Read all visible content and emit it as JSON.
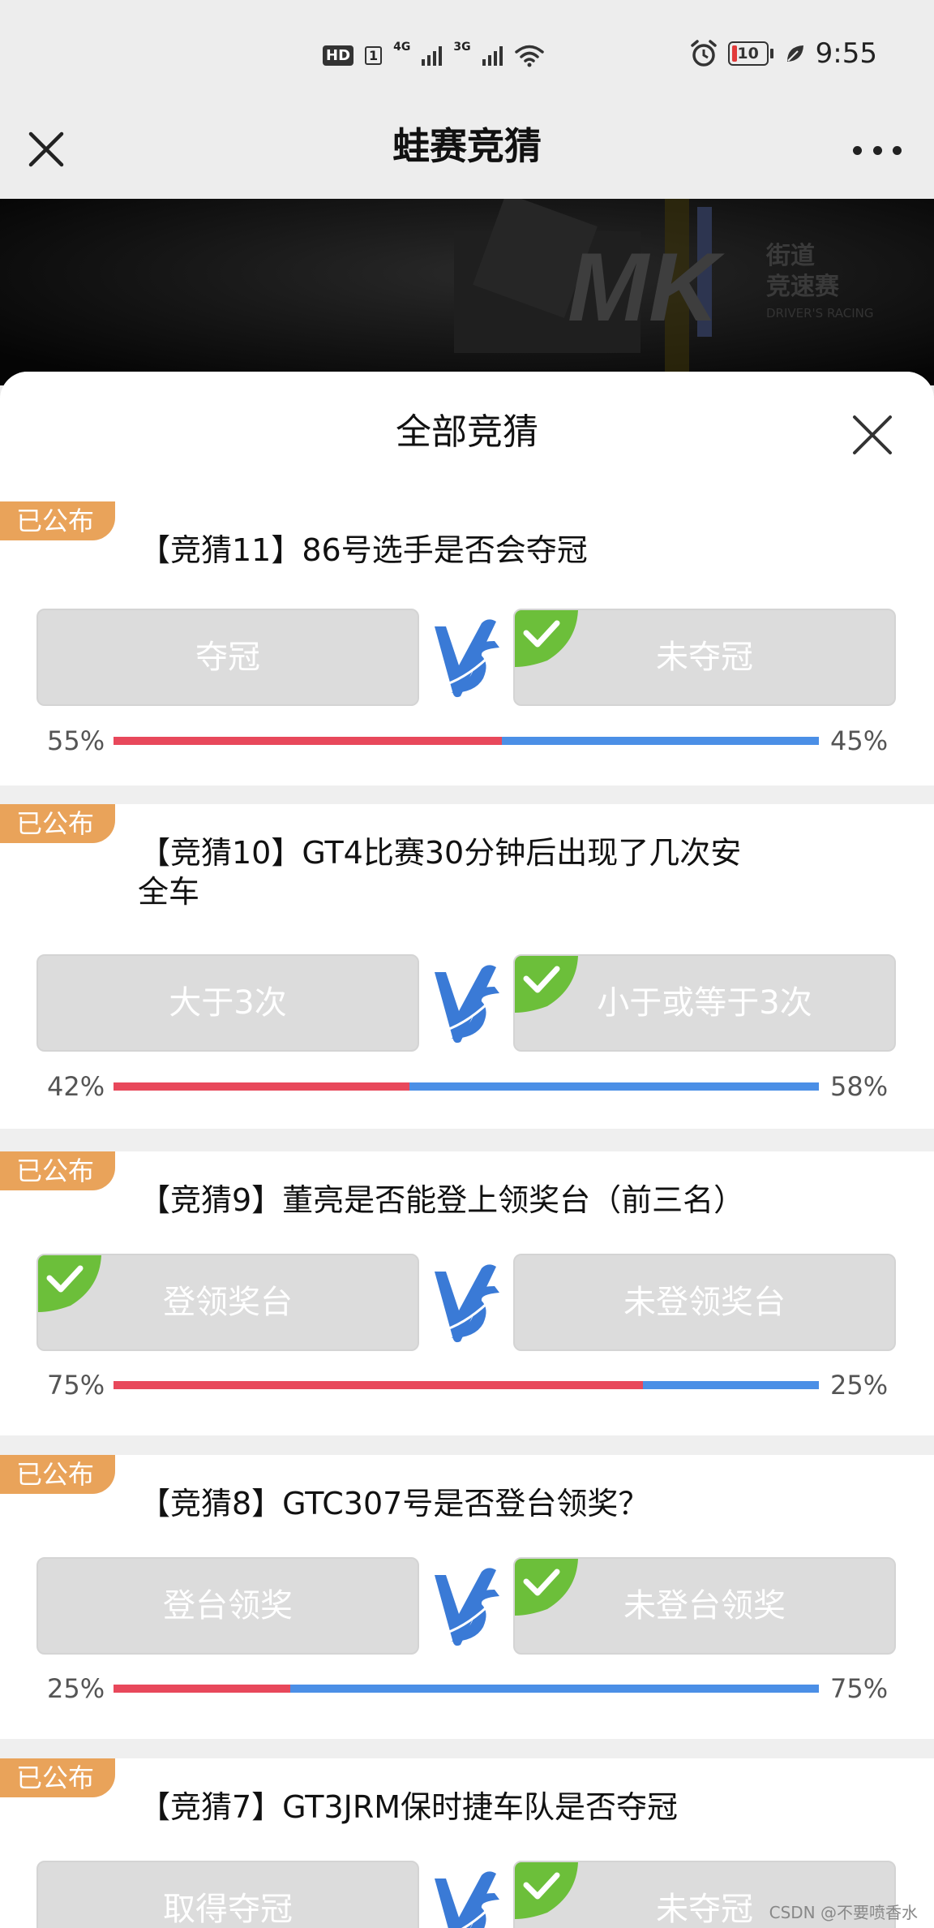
{
  "status_bar": {
    "hd_label": "HD",
    "sim_number": "1",
    "network_1": "4G",
    "network_2": "3G",
    "battery_level": "10",
    "time": "9:55"
  },
  "nav": {
    "title": "蛙赛竞猜"
  },
  "sheet": {
    "title": "全部竞猜"
  },
  "colors": {
    "tag_bg": "#e9a35a",
    "bar_left": "#e8485b",
    "bar_right": "#4b8fe6",
    "check_bg": "#6cbf3a",
    "vs_blue": "#3a7ad6"
  },
  "cards": [
    {
      "tag": "已公布",
      "title": "【竞猜11】86号选手是否会夺冠",
      "left_option": "夺冠",
      "right_option": "未夺冠",
      "winner": "right",
      "left_percent": "55%",
      "right_percent": "45%",
      "left_value": 55
    },
    {
      "tag": "已公布",
      "title_line1": "【竞猜10】GT4比赛30分钟后出现了几次安",
      "title_line2": "全车",
      "left_option": "大于3次",
      "right_option": "小于或等于3次",
      "winner": "right",
      "left_percent": "42%",
      "right_percent": "58%",
      "left_value": 42
    },
    {
      "tag": "已公布",
      "title": "【竞猜9】董亮是否能登上领奖台（前三名）",
      "left_option": "登领奖台",
      "right_option": "未登领奖台",
      "winner": "left",
      "left_percent": "75%",
      "right_percent": "25%",
      "left_value": 75
    },
    {
      "tag": "已公布",
      "title": "【竞猜8】GTC307号是否登台领奖？",
      "left_option": "登台领奖",
      "right_option": "未登台领奖",
      "winner": "right",
      "left_percent": "25%",
      "right_percent": "75%",
      "left_value": 25
    },
    {
      "tag": "已公布",
      "title": "【竞猜7】GT3JRM保时捷车队是否夺冠",
      "left_option": "取得夺冠",
      "right_option": "未夺冠",
      "winner": "right"
    }
  ],
  "watermark": "CSDN @不要喷香水"
}
